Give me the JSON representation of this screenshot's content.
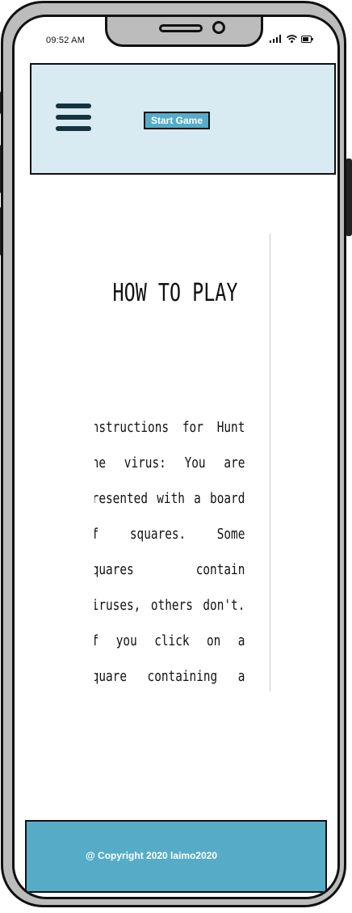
{
  "status_bar": {
    "time": "09:52 AM"
  },
  "header": {
    "menu_icon": "hamburger-menu-icon",
    "start_button_label": "Start Game"
  },
  "main": {
    "title": "HOW TO PLAY",
    "instructions": "Instructions for Hunt the virus: You are presented with a board of squares. Some squares contain viruses, others don't. If you click on a square containing a virus, you lose. If you manage to"
  },
  "footer": {
    "copyright": "@ Copyright 2020 laimo2020"
  },
  "colors": {
    "header_bg": "#d8eaf2",
    "accent": "#56acc7",
    "frame": "#bcbcbc",
    "dark": "#17323f"
  }
}
